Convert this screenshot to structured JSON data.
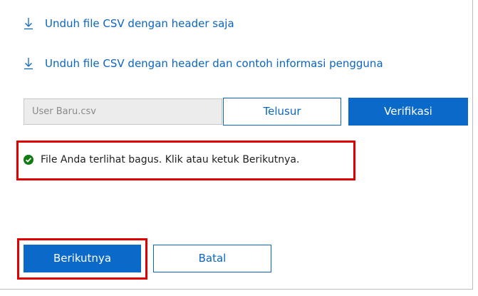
{
  "downloads": {
    "header_only": {
      "label": "Unduh file CSV dengan header saja",
      "icon": "download-icon"
    },
    "header_with_sample": {
      "label": "Unduh file CSV dengan header dan contoh informasi pengguna",
      "icon": "download-icon"
    }
  },
  "upload": {
    "file_name": "User Baru.csv",
    "browse_label": "Telusur",
    "verify_label": "Verifikasi"
  },
  "status": {
    "icon": "check-circle-icon",
    "message": "File Anda terlihat bagus. Klik atau ketuk Berikutnya."
  },
  "actions": {
    "next_label": "Berikutnya",
    "cancel_label": "Batal"
  },
  "colors": {
    "accent": "#0b6ac9",
    "success": "#107c10",
    "highlight": "#e00000"
  }
}
